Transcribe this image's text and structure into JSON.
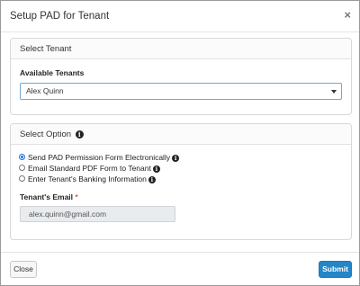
{
  "modal": {
    "title": "Setup PAD for Tenant",
    "close_glyph": "×"
  },
  "select_tenant": {
    "heading": "Select Tenant",
    "label": "Available Tenants",
    "selected_value": "Alex Quinn"
  },
  "select_option": {
    "heading": "Select Option",
    "options": [
      {
        "label": "Send PAD Permission Form Electronically",
        "checked": true
      },
      {
        "label": "Email Standard PDF Form to Tenant",
        "checked": false
      },
      {
        "label": "Enter Tenant's Banking Information",
        "checked": false
      }
    ],
    "email_label": "Tenant's Email",
    "required_mark": "*",
    "email_value": "alex.quinn@gmail.com"
  },
  "footer": {
    "close_label": "Close",
    "submit_label": "Submit"
  },
  "colors": {
    "primary": "#2386c7",
    "required": "#d9534f",
    "radio_checked": "#1a73e8"
  },
  "icons": {
    "info": "info-circle-icon",
    "close": "close-icon",
    "caret": "chevron-down-icon"
  }
}
